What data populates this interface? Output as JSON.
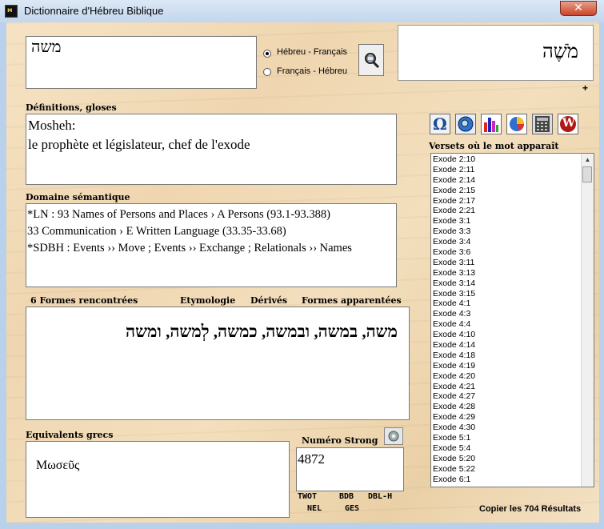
{
  "window": {
    "title": "Dictionnaire d'Hébreu Biblique",
    "close_glyph": "✕"
  },
  "search": {
    "value": "משה",
    "radio_hebrew_french": "Hébreu - Français",
    "radio_french_hebrew": "Français - Hébreu",
    "selected_mode": "Hébreu - Français",
    "display_word": "מֹשֶׁה",
    "plus": "+"
  },
  "definitions": {
    "label": "Définitions, gloses",
    "line1": "Mosheh:",
    "line2": "le prophète et législateur, chef de l'exode"
  },
  "semantic": {
    "label": "Domaine sémantique",
    "line1": "*LN : 93 Names of Persons and Places › A Persons (93.1-93.388)",
    "line2": "33 Communication › E Written Language (33.35-33.68)",
    "line3": "*SDBH : Events ›› Move ; Events ›› Exchange ; Relationals ›› Names"
  },
  "forms": {
    "label": "6 Formes rencontrées",
    "etymology": "Etymologie",
    "derived": "Dérivés",
    "related": "Formes apparentées",
    "text": "משה, במשה, ובמשה, כמשה, לְמשה, ומשה"
  },
  "greek": {
    "label": "Equivalents grecs",
    "value": "Μωσεῦς"
  },
  "strong": {
    "label": "Numéro Strong",
    "value": "4872",
    "links": [
      "TWOT",
      "BDB",
      "DBL-H",
      "NEL",
      "GES"
    ]
  },
  "toolbar": {
    "icons": [
      "omega-icon",
      "search-globe-icon",
      "bar-chart-icon",
      "pie-chart-icon",
      "calculator-icon",
      "w-logo-icon"
    ],
    "omega_glyph": "Ω",
    "w_glyph": "W"
  },
  "verses": {
    "label": "Versets où le mot apparaît",
    "items": [
      "Exode 2:10",
      "Exode 2:11",
      "Exode 2:14",
      "Exode 2:15",
      "Exode 2:17",
      "Exode 2:21",
      "Exode 3:1",
      "Exode 3:3",
      "Exode 3:4",
      "Exode 3:6",
      "Exode 3:11",
      "Exode 3:13",
      "Exode 3:14",
      "Exode 3:15",
      "Exode 4:1",
      "Exode 4:3",
      "Exode 4:4",
      "Exode 4:10",
      "Exode 4:14",
      "Exode 4:18",
      "Exode 4:19",
      "Exode 4:20",
      "Exode 4:21",
      "Exode 4:27",
      "Exode 4:28",
      "Exode 4:29",
      "Exode 4:30",
      "Exode 5:1",
      "Exode 5:4",
      "Exode 5:20",
      "Exode 5:22",
      "Exode 6:1"
    ],
    "copy_label": "Copier les 704 Résultats"
  }
}
